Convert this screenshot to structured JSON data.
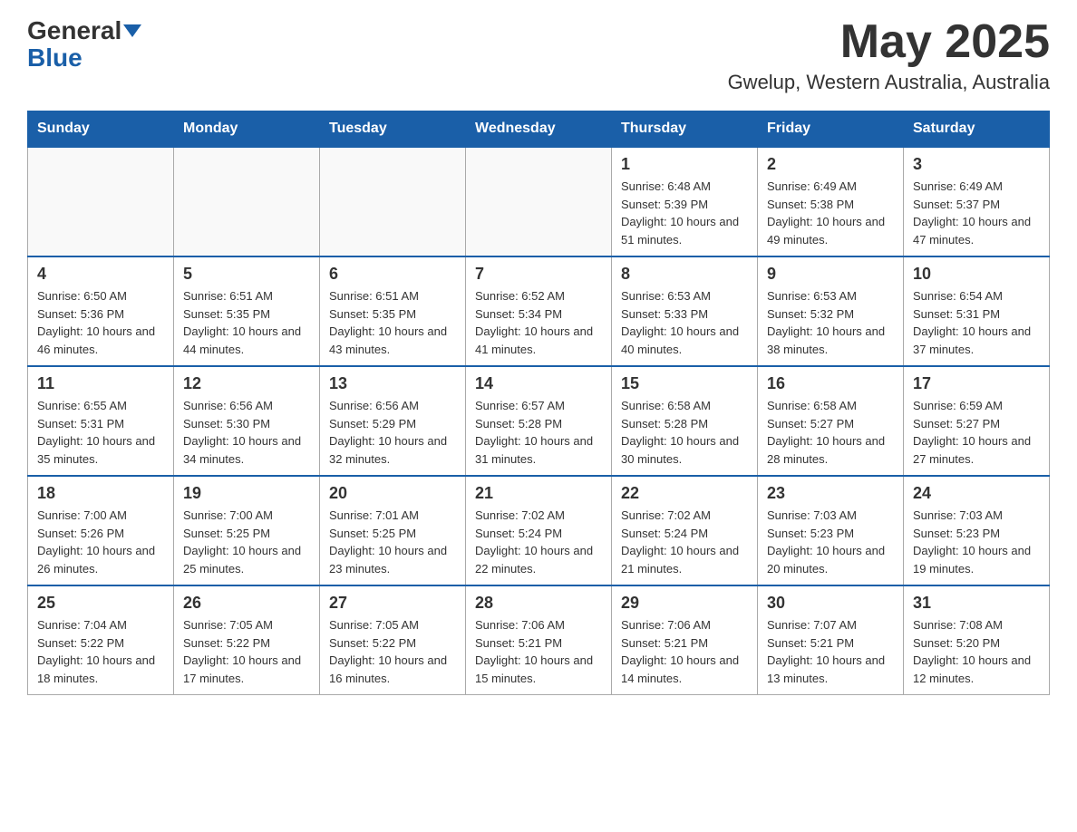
{
  "header": {
    "logo_general": "General",
    "logo_blue": "Blue",
    "month_title": "May 2025",
    "location": "Gwelup, Western Australia, Australia"
  },
  "days_of_week": [
    "Sunday",
    "Monday",
    "Tuesday",
    "Wednesday",
    "Thursday",
    "Friday",
    "Saturday"
  ],
  "weeks": [
    [
      {
        "day": "",
        "info": ""
      },
      {
        "day": "",
        "info": ""
      },
      {
        "day": "",
        "info": ""
      },
      {
        "day": "",
        "info": ""
      },
      {
        "day": "1",
        "info": "Sunrise: 6:48 AM\nSunset: 5:39 PM\nDaylight: 10 hours and 51 minutes."
      },
      {
        "day": "2",
        "info": "Sunrise: 6:49 AM\nSunset: 5:38 PM\nDaylight: 10 hours and 49 minutes."
      },
      {
        "day": "3",
        "info": "Sunrise: 6:49 AM\nSunset: 5:37 PM\nDaylight: 10 hours and 47 minutes."
      }
    ],
    [
      {
        "day": "4",
        "info": "Sunrise: 6:50 AM\nSunset: 5:36 PM\nDaylight: 10 hours and 46 minutes."
      },
      {
        "day": "5",
        "info": "Sunrise: 6:51 AM\nSunset: 5:35 PM\nDaylight: 10 hours and 44 minutes."
      },
      {
        "day": "6",
        "info": "Sunrise: 6:51 AM\nSunset: 5:35 PM\nDaylight: 10 hours and 43 minutes."
      },
      {
        "day": "7",
        "info": "Sunrise: 6:52 AM\nSunset: 5:34 PM\nDaylight: 10 hours and 41 minutes."
      },
      {
        "day": "8",
        "info": "Sunrise: 6:53 AM\nSunset: 5:33 PM\nDaylight: 10 hours and 40 minutes."
      },
      {
        "day": "9",
        "info": "Sunrise: 6:53 AM\nSunset: 5:32 PM\nDaylight: 10 hours and 38 minutes."
      },
      {
        "day": "10",
        "info": "Sunrise: 6:54 AM\nSunset: 5:31 PM\nDaylight: 10 hours and 37 minutes."
      }
    ],
    [
      {
        "day": "11",
        "info": "Sunrise: 6:55 AM\nSunset: 5:31 PM\nDaylight: 10 hours and 35 minutes."
      },
      {
        "day": "12",
        "info": "Sunrise: 6:56 AM\nSunset: 5:30 PM\nDaylight: 10 hours and 34 minutes."
      },
      {
        "day": "13",
        "info": "Sunrise: 6:56 AM\nSunset: 5:29 PM\nDaylight: 10 hours and 32 minutes."
      },
      {
        "day": "14",
        "info": "Sunrise: 6:57 AM\nSunset: 5:28 PM\nDaylight: 10 hours and 31 minutes."
      },
      {
        "day": "15",
        "info": "Sunrise: 6:58 AM\nSunset: 5:28 PM\nDaylight: 10 hours and 30 minutes."
      },
      {
        "day": "16",
        "info": "Sunrise: 6:58 AM\nSunset: 5:27 PM\nDaylight: 10 hours and 28 minutes."
      },
      {
        "day": "17",
        "info": "Sunrise: 6:59 AM\nSunset: 5:27 PM\nDaylight: 10 hours and 27 minutes."
      }
    ],
    [
      {
        "day": "18",
        "info": "Sunrise: 7:00 AM\nSunset: 5:26 PM\nDaylight: 10 hours and 26 minutes."
      },
      {
        "day": "19",
        "info": "Sunrise: 7:00 AM\nSunset: 5:25 PM\nDaylight: 10 hours and 25 minutes."
      },
      {
        "day": "20",
        "info": "Sunrise: 7:01 AM\nSunset: 5:25 PM\nDaylight: 10 hours and 23 minutes."
      },
      {
        "day": "21",
        "info": "Sunrise: 7:02 AM\nSunset: 5:24 PM\nDaylight: 10 hours and 22 minutes."
      },
      {
        "day": "22",
        "info": "Sunrise: 7:02 AM\nSunset: 5:24 PM\nDaylight: 10 hours and 21 minutes."
      },
      {
        "day": "23",
        "info": "Sunrise: 7:03 AM\nSunset: 5:23 PM\nDaylight: 10 hours and 20 minutes."
      },
      {
        "day": "24",
        "info": "Sunrise: 7:03 AM\nSunset: 5:23 PM\nDaylight: 10 hours and 19 minutes."
      }
    ],
    [
      {
        "day": "25",
        "info": "Sunrise: 7:04 AM\nSunset: 5:22 PM\nDaylight: 10 hours and 18 minutes."
      },
      {
        "day": "26",
        "info": "Sunrise: 7:05 AM\nSunset: 5:22 PM\nDaylight: 10 hours and 17 minutes."
      },
      {
        "day": "27",
        "info": "Sunrise: 7:05 AM\nSunset: 5:22 PM\nDaylight: 10 hours and 16 minutes."
      },
      {
        "day": "28",
        "info": "Sunrise: 7:06 AM\nSunset: 5:21 PM\nDaylight: 10 hours and 15 minutes."
      },
      {
        "day": "29",
        "info": "Sunrise: 7:06 AM\nSunset: 5:21 PM\nDaylight: 10 hours and 14 minutes."
      },
      {
        "day": "30",
        "info": "Sunrise: 7:07 AM\nSunset: 5:21 PM\nDaylight: 10 hours and 13 minutes."
      },
      {
        "day": "31",
        "info": "Sunrise: 7:08 AM\nSunset: 5:20 PM\nDaylight: 10 hours and 12 minutes."
      }
    ]
  ]
}
